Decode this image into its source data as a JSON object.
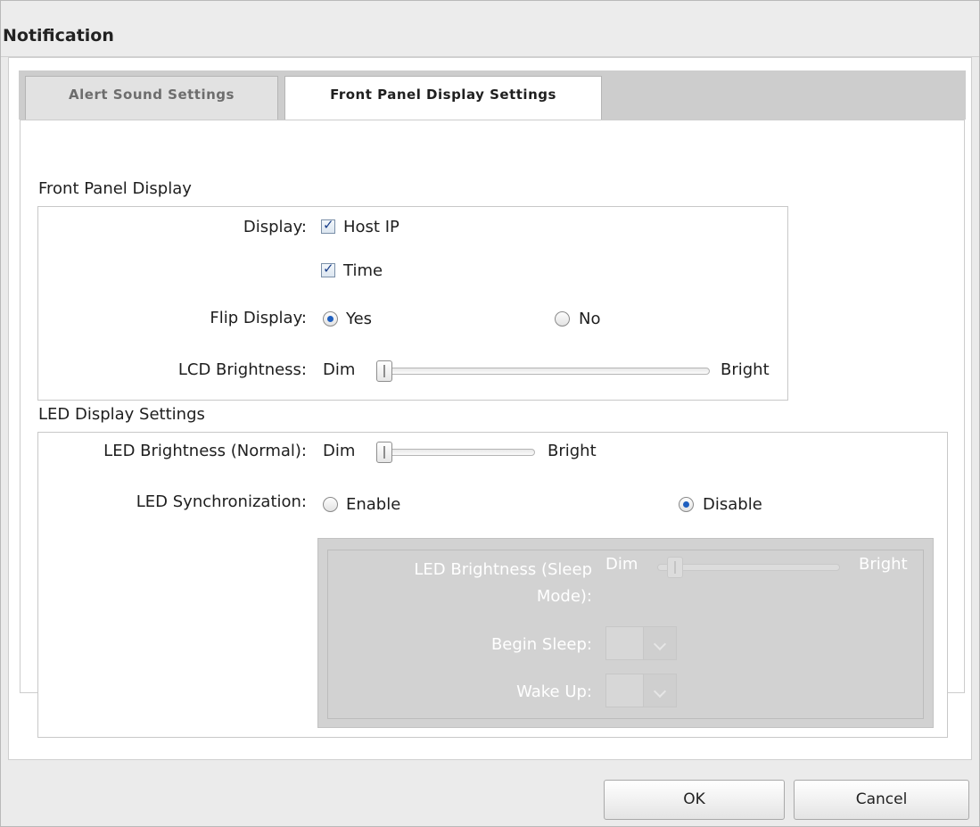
{
  "dialog": {
    "title": "Notification"
  },
  "help": {
    "glyph": "?"
  },
  "tabs": [
    {
      "label": "Alert Sound Settings",
      "active": false
    },
    {
      "label": "Front Panel Display Settings",
      "active": true
    }
  ],
  "front_panel": {
    "section_title": "Front Panel Display",
    "display_label": "Display:",
    "host_ip_label": "Host IP",
    "host_ip_checked": true,
    "time_label": "Time",
    "time_checked": true,
    "flip_label": "Flip Display:",
    "flip_yes": "Yes",
    "flip_no": "No",
    "flip_selected": "Yes",
    "lcd_label": "LCD Brightness:",
    "lcd_min": "Dim",
    "lcd_max": "Bright",
    "lcd_value": 0
  },
  "led": {
    "section_title": "LED Display Settings",
    "normal_label": "LED Brightness (Normal):",
    "normal_min": "Dim",
    "normal_max": "Bright",
    "normal_value": 0,
    "sync_label": "LED Synchronization:",
    "sync_enable": "Enable",
    "sync_disable": "Disable",
    "sync_selected": "Disable",
    "sleep_label_1": "LED Brightness (Sleep",
    "sleep_label_2": "Mode):",
    "sleep_min": "Dim",
    "sleep_max": "Bright",
    "begin_sleep_label": "Begin Sleep:",
    "wake_up_label": "Wake Up:"
  },
  "buttons": {
    "ok": "OK",
    "cancel": "Cancel"
  }
}
